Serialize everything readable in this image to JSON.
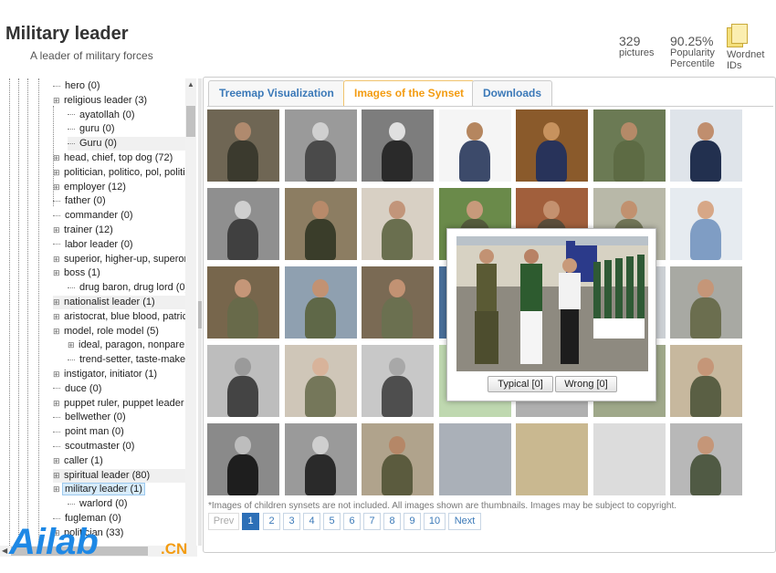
{
  "header": {
    "title": "Military leader",
    "subtitle": "A leader of military forces",
    "pictures_count": "329",
    "pictures_label": "pictures",
    "popularity_value": "90.25%",
    "popularity_label1": "Popularity",
    "popularity_label2": "Percentile",
    "wordnet_label1": "Wordnet",
    "wordnet_label2": "IDs",
    "wordnet_icon": "document-stack-icon"
  },
  "tree": {
    "rows": [
      {
        "label": "hero (0)"
      },
      {
        "label": "religious leader (3)"
      },
      {
        "label": "ayatollah (0)"
      },
      {
        "label": "guru (0)"
      },
      {
        "label": "Guru (0)"
      },
      {
        "label": "head, chief, top dog (72)"
      },
      {
        "label": "politician, politico, pol, politi"
      },
      {
        "label": "employer (12)"
      },
      {
        "label": "father (0)"
      },
      {
        "label": "commander (0)"
      },
      {
        "label": "trainer (12)"
      },
      {
        "label": "labor leader (0)"
      },
      {
        "label": "superior, higher-up, superor"
      },
      {
        "label": "boss (1)"
      },
      {
        "label": "drug baron, drug lord (0)"
      },
      {
        "label": "nationalist leader (1)"
      },
      {
        "label": "aristocrat, blue blood, patric"
      },
      {
        "label": "model, role model (5)"
      },
      {
        "label": "ideal, paragon, nonpare"
      },
      {
        "label": "trend-setter, taste-maker"
      },
      {
        "label": "instigator, initiator (1)"
      },
      {
        "label": "duce (0)"
      },
      {
        "label": "puppet ruler, puppet leader"
      },
      {
        "label": "bellwether (0)"
      },
      {
        "label": "point man (0)"
      },
      {
        "label": "scoutmaster (0)"
      },
      {
        "label": "caller (1)"
      },
      {
        "label": "spiritual leader (80)"
      },
      {
        "label": "military leader (1)"
      },
      {
        "label": "warlord (0)"
      },
      {
        "label": "fugleman (0)"
      },
      {
        "label": "politician (33)"
      }
    ]
  },
  "tabs": [
    {
      "label": "Treemap Visualization"
    },
    {
      "label": "Images of the Synset"
    },
    {
      "label": "Downloads"
    }
  ],
  "popup": {
    "typical_label": "Typical [0]",
    "wrong_label": "Wrong [0]"
  },
  "note": "*Images of children synsets are not included. All images shown are thumbnails. Images may be subject to copyright.",
  "pagination": {
    "prev": "Prev",
    "pages": [
      "1",
      "2",
      "3",
      "4",
      "5",
      "6",
      "7",
      "8",
      "9",
      "10"
    ],
    "next": "Next"
  },
  "watermark": {
    "brand": "Ailab",
    "suffix": ".CN"
  },
  "colors": {
    "tab_active": "#f39c12",
    "link": "#3b79b8",
    "page_current": "#2c6fb7"
  }
}
